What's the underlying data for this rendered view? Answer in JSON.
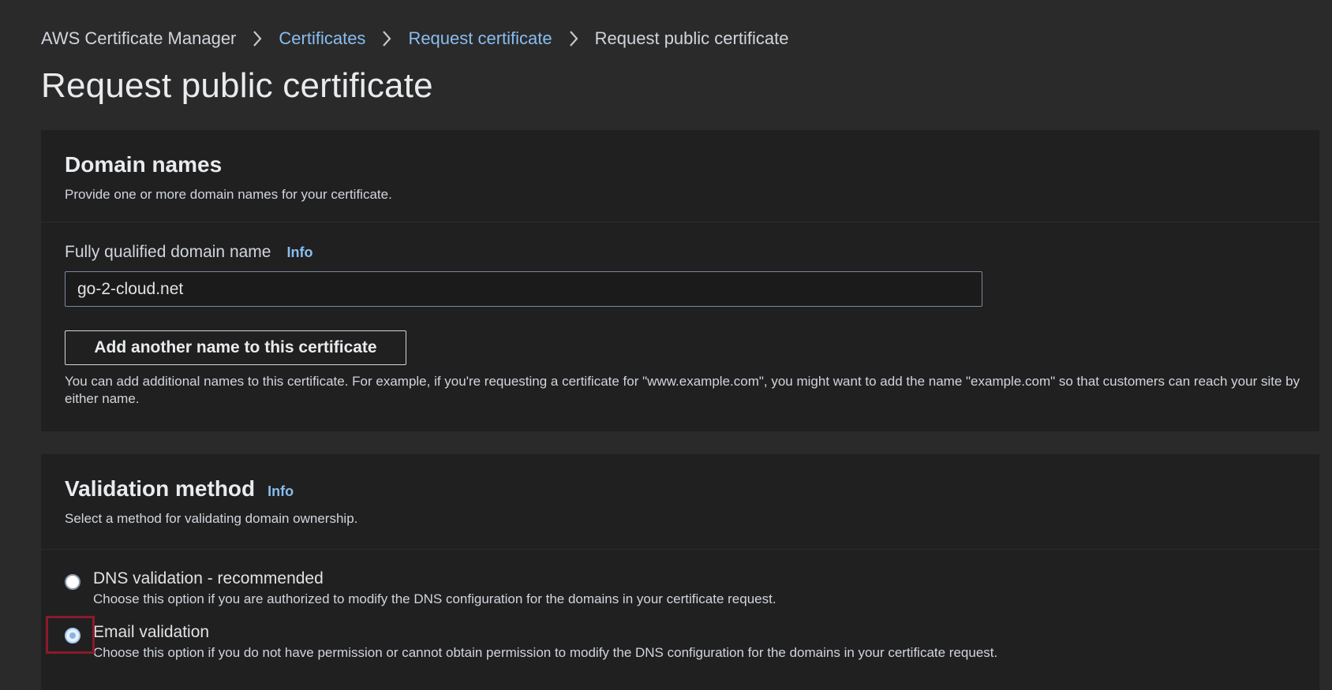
{
  "breadcrumb": {
    "items": [
      {
        "label": "AWS Certificate Manager"
      },
      {
        "label": "Certificates"
      },
      {
        "label": "Request certificate"
      },
      {
        "label": "Request public certificate"
      }
    ]
  },
  "page": {
    "title": "Request public certificate"
  },
  "domain_names": {
    "title": "Domain names",
    "description": "Provide one or more domain names for your certificate.",
    "fqdn_label": "Fully qualified domain name",
    "fqdn_info": "Info",
    "fqdn_value": "go-2-cloud.net",
    "add_button": "Add another name to this certificate",
    "help_text": "You can add additional names to this certificate. For example, if you're requesting a certificate for \"www.example.com\", you might want to add the name \"example.com\" so that customers can reach your site by either name."
  },
  "validation_method": {
    "title": "Validation method",
    "info": "Info",
    "description": "Select a method for validating domain ownership.",
    "options": [
      {
        "label": "DNS validation - recommended",
        "description": "Choose this option if you are authorized to modify the DNS configuration for the domains in your certificate request.",
        "selected": false
      },
      {
        "label": "Email validation",
        "description": "Choose this option if you do not have permission or cannot obtain permission to modify the DNS configuration for the domains in your certificate request.",
        "selected": true
      }
    ]
  },
  "colors": {
    "background": "#2a2a2b",
    "panel": "#202021",
    "link": "#89bdee",
    "highlight": "#8b1a2b"
  },
  "icons": {
    "breadcrumb_separator": "chevron-right-icon"
  }
}
